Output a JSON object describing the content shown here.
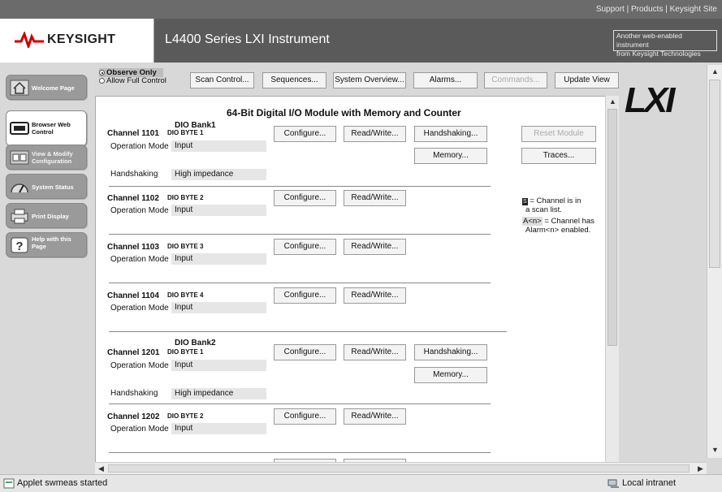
{
  "top_links": {
    "support": "Support",
    "products": "Products",
    "keysight_site": "Keysight Site",
    "sep": " | "
  },
  "header": {
    "logo_text": "KEYSIGHT",
    "title": "L4400 Series LXI Instrument",
    "another_line1": "Another web-enabled instrument",
    "another_line2": "from Keysight Technologies"
  },
  "sidebar": {
    "items": [
      {
        "label": "Welcome Page"
      },
      {
        "label": "Browser Web Control"
      },
      {
        "label": "View & Modify Configuration"
      },
      {
        "label": "System Status"
      },
      {
        "label": "Print Display"
      },
      {
        "label": "Help with this Page"
      }
    ]
  },
  "toolbar": {
    "observe_only": "Observe Only",
    "allow_full": "Allow Full Control",
    "scan_control": "Scan Control...",
    "sequences": "Sequences...",
    "system_overview": "System Overview...",
    "alarms": "Alarms...",
    "commands": "Commands...",
    "update_view": "Update View"
  },
  "lxi_logo": "LXI",
  "module": {
    "title": "64-Bit Digital I/O Module with Memory and Counter",
    "bank1": "DIO Bank1",
    "bank2": "DIO Bank2",
    "reset_module": "Reset Module",
    "traces": "Traces...",
    "operation_mode_label": "Operation Mode",
    "handshaking_label": "Handshaking",
    "configure": "Configure...",
    "read_write": "Read/Write...",
    "handshaking_btn": "Handshaking...",
    "memory_btn": "Memory...",
    "channels": [
      {
        "channel": "Channel 1101",
        "byte": "DIO BYTE 1",
        "mode": "Input",
        "handshaking": "High impedance"
      },
      {
        "channel": "Channel 1102",
        "byte": "DIO BYTE 2",
        "mode": "Input"
      },
      {
        "channel": "Channel 1103",
        "byte": "DIO BYTE 3",
        "mode": "Input"
      },
      {
        "channel": "Channel 1104",
        "byte": "DIO BYTE 4",
        "mode": "Input"
      },
      {
        "channel": "Channel 1201",
        "byte": "DIO BYTE 1",
        "mode": "Input",
        "handshaking": "High impedance"
      },
      {
        "channel": "Channel 1202",
        "byte": "DIO BYTE 2",
        "mode": "Input"
      }
    ]
  },
  "legend": {
    "scan_box": "S",
    "scan_text1": "= Channel is in",
    "scan_text2": "a scan list.",
    "alarm_box": "A<n>",
    "alarm_text1": "= Channel has",
    "alarm_text2": "Alarm<n> enabled."
  },
  "status": {
    "message": "Applet swmeas started",
    "zone": "Local intranet"
  }
}
